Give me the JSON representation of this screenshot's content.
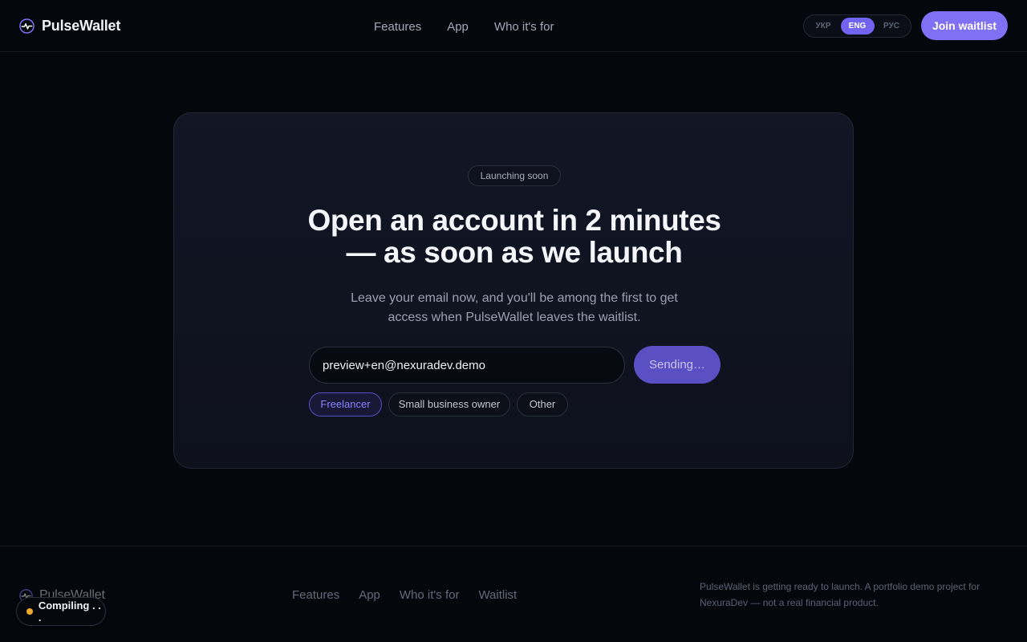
{
  "header": {
    "brand": "PulseWallet",
    "nav": [
      "Features",
      "App",
      "Who it's for"
    ],
    "languages": [
      {
        "label": "УКР",
        "active": false
      },
      {
        "label": "ENG",
        "active": true
      },
      {
        "label": "РУС",
        "active": false
      }
    ],
    "cta_label": "Join waitlist"
  },
  "hero": {
    "badge": "Launching soon",
    "headline_line1": "Open an account in 2 minutes",
    "headline_line2": "— as soon as we launch",
    "subtitle": "Leave your email now, and you'll be among the first to get access when PulseWallet leaves the waitlist.",
    "email_value": "preview+en@nexuradev.demo",
    "submit_label": "Sending…",
    "roles": [
      {
        "label": "Freelancer",
        "selected": true
      },
      {
        "label": "Small business owner",
        "selected": false
      },
      {
        "label": "Other",
        "selected": false
      }
    ]
  },
  "footer": {
    "brand": "PulseWallet",
    "nav": [
      "Features",
      "App",
      "Who it's for",
      "Waitlist"
    ],
    "note": "PulseWallet is getting ready to launch. A portfolio demo project for NexuraDev — not a real financial product."
  },
  "status_toast": {
    "label": "Compiling . . ."
  },
  "colors": {
    "background": "#05070d",
    "accent": "#8070f4",
    "accent_pending": "#5b4fc4",
    "status_dot": "#f3a92b"
  },
  "icons": {
    "brand": "pulse-icon"
  }
}
